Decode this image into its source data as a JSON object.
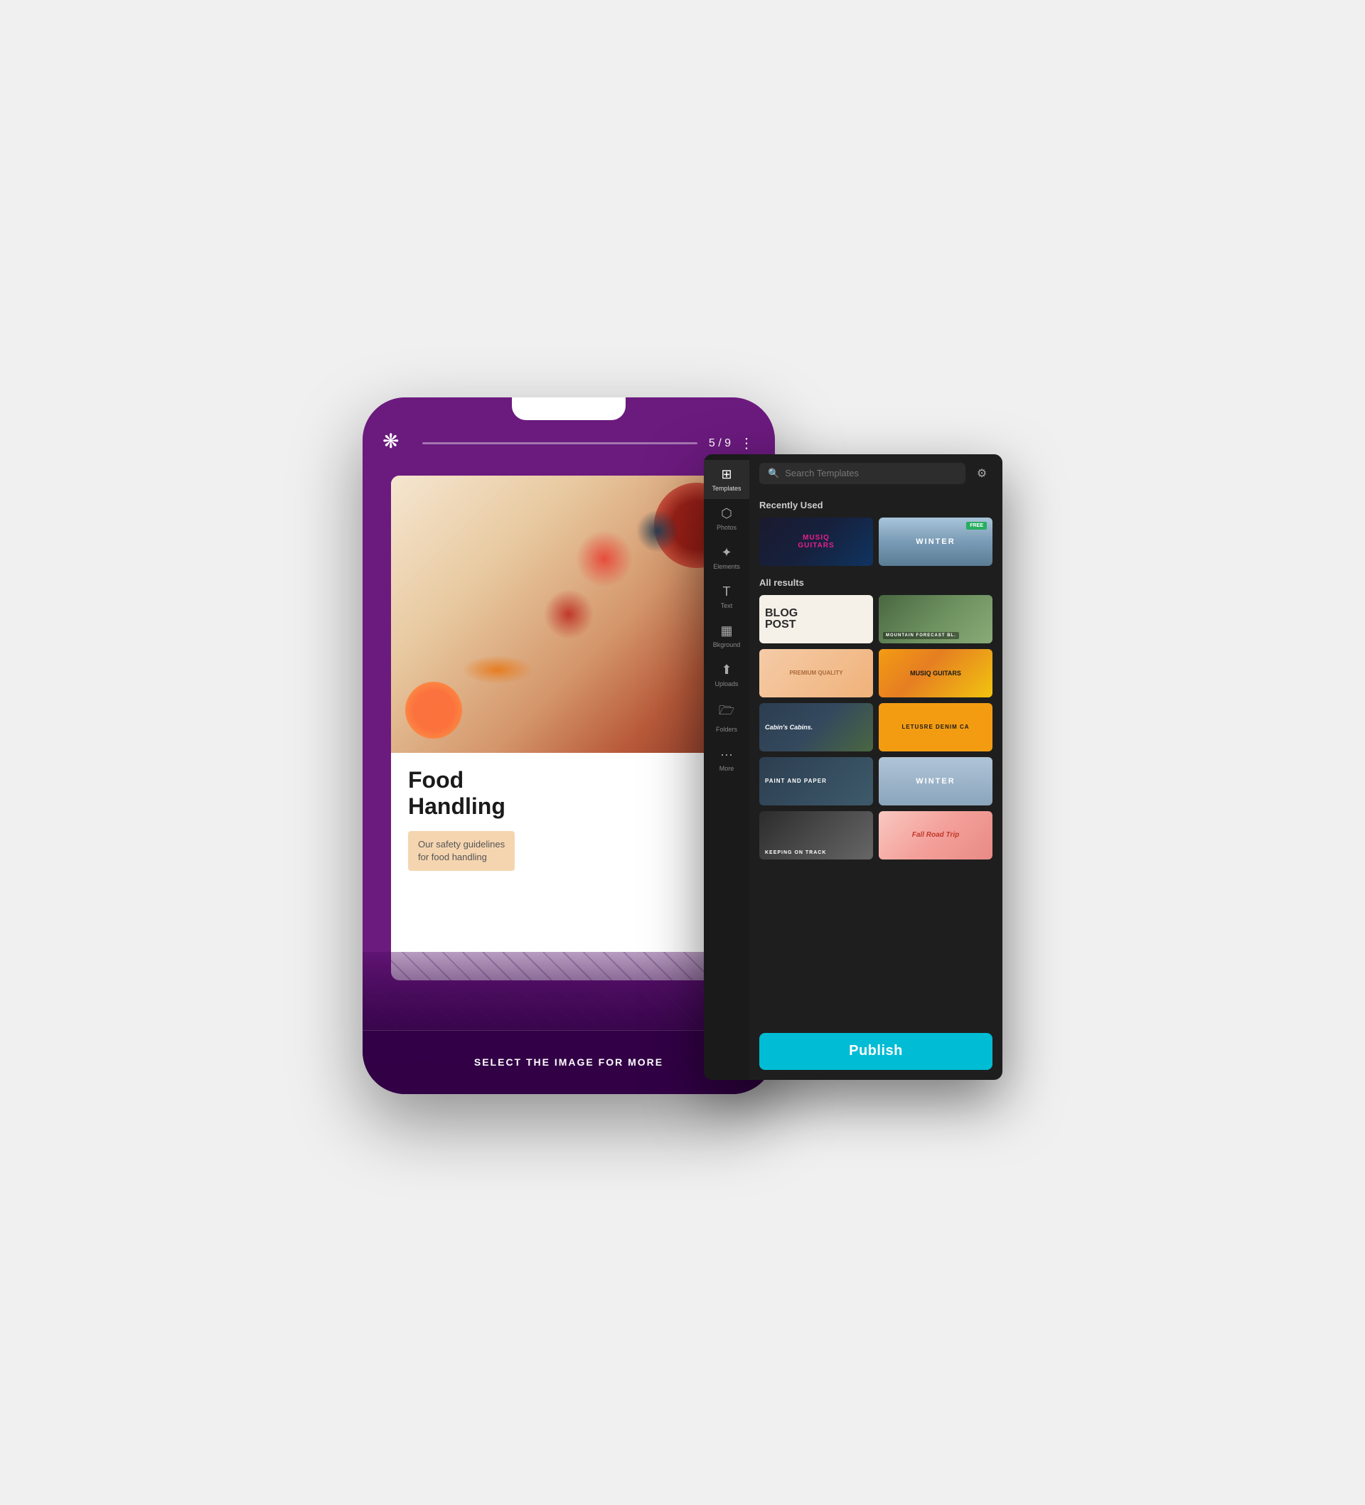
{
  "phone": {
    "logo": "❋",
    "counter": "5 / 9",
    "menu_dots": "⋮",
    "card": {
      "title": "Food\nHandling",
      "subtitle_line1": "Our safety guidelines",
      "subtitle_line2": "for food handling"
    },
    "bottom_text": "SELECT THE IMAGE FOR MORE"
  },
  "template_panel": {
    "sidebar_items": [
      {
        "icon": "⊞",
        "label": "Templates",
        "active": true
      },
      {
        "icon": "⬡",
        "label": "Photos",
        "active": false
      },
      {
        "icon": "✦",
        "label": "Elements",
        "active": false
      },
      {
        "icon": "T",
        "label": "Text",
        "active": false
      },
      {
        "icon": "▦",
        "label": "Bkground",
        "active": false
      },
      {
        "icon": "⬆",
        "label": "Uploads",
        "active": false
      },
      {
        "icon": "📁",
        "label": "Folders",
        "active": false
      },
      {
        "icon": "•••",
        "label": "More",
        "active": false
      }
    ],
    "search": {
      "placeholder": "Search Templates"
    },
    "recently_used_label": "Recently Used",
    "all_results_label": "All results",
    "recently_used": [
      {
        "id": "musiq-guitars",
        "type": "musiq",
        "text": "MUSIQ GUITARS"
      },
      {
        "id": "winter",
        "type": "winter",
        "text": "WINTER",
        "badge": "FREE"
      }
    ],
    "all_results": [
      {
        "id": "blog-post",
        "type": "blog",
        "text": "BLOG\nPOST"
      },
      {
        "id": "mountain",
        "type": "mountain",
        "text": "MOUNTAIN FORECAST BL."
      },
      {
        "id": "peach-quality",
        "type": "peach",
        "text": "PREMIUM QUALITY"
      },
      {
        "id": "musiq-guitars2",
        "type": "musiq2",
        "text": "MUSIQ GUITARS"
      },
      {
        "id": "cabins",
        "type": "cabins",
        "text": "Cabin's Cabins."
      },
      {
        "id": "leisure",
        "type": "leisure",
        "text": "LETUSRE DENIM CA"
      },
      {
        "id": "paint-paper",
        "type": "paint",
        "text": "PAINT AND PAPER"
      },
      {
        "id": "winter2",
        "type": "winter2",
        "text": "WINTER"
      },
      {
        "id": "keeping-track",
        "type": "keeping",
        "text": "KEEPING ON TRACK"
      },
      {
        "id": "road-trip",
        "type": "roadtrip",
        "text": "Fall Road Trip"
      }
    ],
    "publish_label": "Publish"
  }
}
